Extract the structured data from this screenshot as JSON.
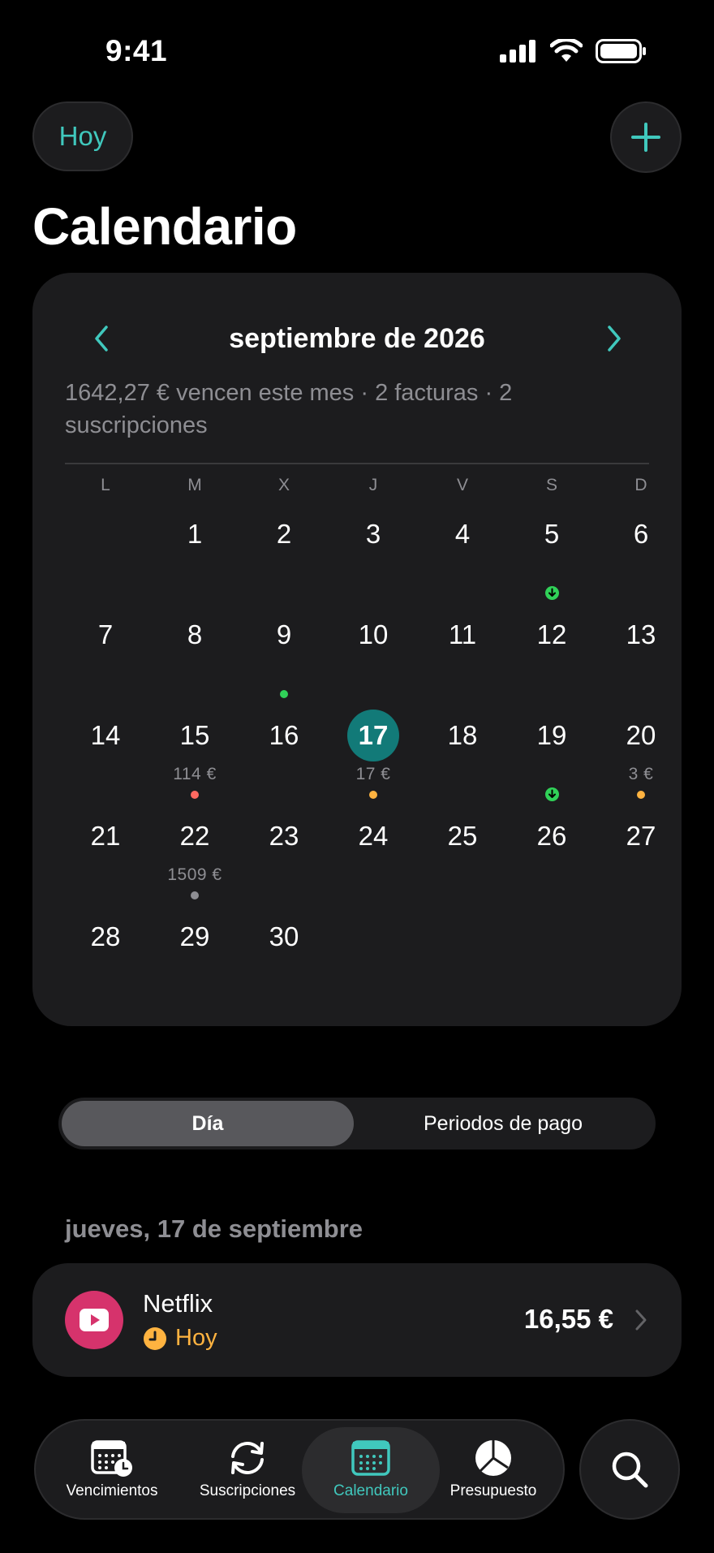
{
  "status_bar": {
    "time": "9:41"
  },
  "header": {
    "today_label": "Hoy",
    "title": "Calendario"
  },
  "calendar": {
    "month_label": "septiembre de 2026",
    "summary": "1642,27 € vencen este mes · 2 facturas · 2 suscripciones",
    "weekdays": [
      "L",
      "M",
      "X",
      "J",
      "V",
      "S",
      "D"
    ],
    "days": {
      "d1": "1",
      "d2": "2",
      "d3": "3",
      "d4": "4",
      "d5": "5",
      "d6": "6",
      "d7": "7",
      "d8": "8",
      "d9": "9",
      "d10": "10",
      "d11": "11",
      "d12": "12",
      "d13": "13",
      "d14": "14",
      "d15": "15",
      "d16": "16",
      "d17": "17",
      "d18": "18",
      "d19": "19",
      "d20": "20",
      "d21": "21",
      "d22": "22",
      "d23": "23",
      "d24": "24",
      "d25": "25",
      "d26": "26",
      "d27": "27",
      "d28": "28",
      "d29": "29",
      "d30": "30"
    },
    "amounts": {
      "d15": "114 €",
      "d17": "17 €",
      "d20": "3 €",
      "d22": "1509 €"
    },
    "dot_colors": {
      "red": "#ff6961",
      "orange": "#ffb340",
      "green": "#30d158",
      "gray": "#8e8e93"
    }
  },
  "segment": {
    "day_label": "Día",
    "periods_label": "Periodos de pago"
  },
  "selected_date_heading": "jueves, 17 de septiembre",
  "item": {
    "name": "Netflix",
    "status": "Hoy",
    "amount": "16,55 €"
  },
  "tabbar": {
    "tabs": [
      {
        "label": "Vencimientos",
        "icon": "calendar-clock-icon"
      },
      {
        "label": "Suscripciones",
        "icon": "refresh-icon"
      },
      {
        "label": "Calendario",
        "icon": "calendar-icon"
      },
      {
        "label": "Presupuesto",
        "icon": "pie-chart-icon"
      }
    ],
    "active_tab": "Calendario"
  },
  "colors": {
    "accent": "#40c8bd",
    "today_circle": "#127a78",
    "background": "#000000",
    "card": "#1c1c1e"
  }
}
